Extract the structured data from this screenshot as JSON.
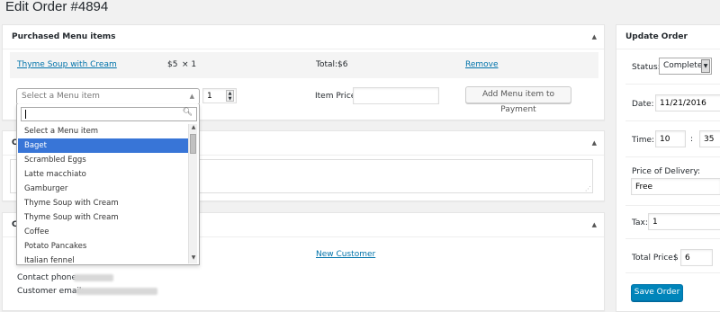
{
  "page": {
    "title": "Edit Order #4894"
  },
  "purchased": {
    "heading": "Purchased Menu items",
    "item": {
      "name": "Thyme Soup with Cream",
      "price": "$5",
      "qty": "× 1",
      "total_label": "Total:",
      "total_value": "$6",
      "remove": "Remove"
    },
    "select_placeholder": "Select a Menu item",
    "qty_value": "1",
    "item_price_label": "Item Price:",
    "item_price_value": "",
    "add_button": "Add Menu item to Payment"
  },
  "dropdown": {
    "search_value": "",
    "options": [
      "Select a Menu item",
      "Baget",
      "Scrambled Eggs",
      "Latte macchiato",
      "Gamburger",
      "Thyme Soup with Cream",
      "Thyme Soup with Cream",
      "Coffee",
      "Potato Pancakes",
      "Italian fennel"
    ],
    "highlighted_index": 1
  },
  "notes_box": {
    "heading_fragment": "O"
  },
  "customer_box": {
    "heading_fragment": "Cu",
    "new_customer_link": "New Customer",
    "contact_phone_label": "Contact phone:",
    "customer_email_label": "Customer email:"
  },
  "update_order": {
    "heading": "Update Order",
    "status_label": "Status:",
    "status_value": "Complete",
    "date_label": "Date:",
    "date_value": "11/21/2016",
    "time_label": "Time:",
    "hour_value": "10",
    "time_sep": ":",
    "minute_value": "35",
    "delivery_label": "Price of Delivery:",
    "delivery_value": "Free",
    "tax_label": "Tax:",
    "tax_value": "1",
    "total_price_label": "Total Price:",
    "currency": "$",
    "total_price_value": "6",
    "save_button": "Save Order"
  },
  "colors": {
    "link": "#0073aa",
    "primary": "#0085ba",
    "highlight": "#3875d7"
  }
}
